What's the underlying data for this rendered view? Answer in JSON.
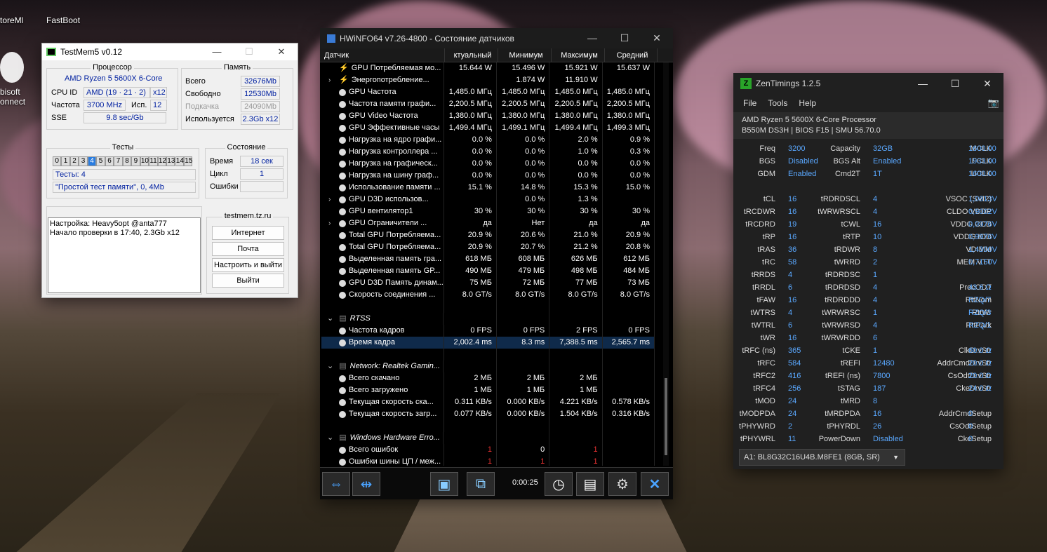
{
  "desktop": {
    "icons": [
      {
        "label": "toreMl"
      },
      {
        "label": "FastBoot"
      },
      {
        "label": "bisoft"
      },
      {
        "label": "onnect"
      }
    ]
  },
  "testmem": {
    "title": "TestMem5 v0.12",
    "cpu": {
      "group": "Процессор",
      "name": "AMD Ryzen 5 5600X 6-Core",
      "cpuid_label": "CPU ID",
      "cpuid": "AMD  (19 · 21 · 2)",
      "threads": "x12",
      "freq_label": "Частота",
      "freq": "3700 MHz",
      "use_label": "Исп.",
      "use": "12",
      "sse_label": "SSE",
      "sse": "9.8 sec/Gb"
    },
    "mem": {
      "group": "Память",
      "total_label": "Всего",
      "total": "32676Mb",
      "free_label": "Свободно",
      "free": "12530Mb",
      "swap_label": "Подкачка",
      "swap": "24090Mb",
      "used_label": "Используется",
      "used": "2.3Gb x12"
    },
    "tests": {
      "group": "Тесты",
      "cells": [
        "0",
        "1",
        "2",
        "3",
        "4",
        "5",
        "6",
        "7",
        "8",
        "9",
        "10",
        "11",
        "12",
        "13",
        "14",
        "15"
      ],
      "active": "4",
      "count": "Тесты: 4",
      "current": "\"Простой тест памяти\", 0, 4Mb"
    },
    "state": {
      "group": "Состояние",
      "time_label": "Время",
      "time": "18 сек",
      "cycle_label": "Цикл",
      "cycle": "1",
      "errors_label": "Ошибки",
      "errors": ""
    },
    "log": {
      "line1": "Настройка: Heavy5opt @anta777",
      "line2": "Начало проверки в 17:40, 2.3Gb x12"
    },
    "site": {
      "group": "testmem.tz.ru",
      "b1": "Интернет",
      "b2": "Почта",
      "b3": "Настроить и выйти",
      "b4": "Выйти"
    }
  },
  "hwinfo": {
    "title": "HWiNFO64 v7.26-4800 - Состояние датчиков",
    "headers": [
      "Датчик",
      "ктуальный",
      "Минимум",
      "Максимум",
      "Средний"
    ],
    "rows": [
      {
        "icon": "bolt",
        "name": "GPU Потребляемая мо...",
        "v": [
          "15.644 W",
          "15.496 W",
          "15.921 W",
          "15.637 W"
        ]
      },
      {
        "icon": "bolt",
        "chev": true,
        "name": "Энергопотребление...",
        "v": [
          "",
          "1.874 W",
          "11.910 W",
          ""
        ]
      },
      {
        "icon": "circle",
        "name": "GPU Частота",
        "v": [
          "1,485.0 МГц",
          "1,485.0 МГц",
          "1,485.0 МГц",
          "1,485.0 МГц"
        ]
      },
      {
        "icon": "circle",
        "name": "Частота памяти графи...",
        "v": [
          "2,200.5 МГц",
          "2,200.5 МГц",
          "2,200.5 МГц",
          "2,200.5 МГц"
        ]
      },
      {
        "icon": "circle",
        "name": "GPU Video Частота",
        "v": [
          "1,380.0 МГц",
          "1,380.0 МГц",
          "1,380.0 МГц",
          "1,380.0 МГц"
        ]
      },
      {
        "icon": "circle",
        "name": "GPU Эффективные часы",
        "v": [
          "1,499.4 МГц",
          "1,499.1 МГц",
          "1,499.4 МГц",
          "1,499.3 МГц"
        ]
      },
      {
        "icon": "circle",
        "name": "Нагрузка на ядро графи...",
        "v": [
          "0.0 %",
          "0.0 %",
          "2.0 %",
          "0.9 %"
        ]
      },
      {
        "icon": "circle",
        "name": "Нагрузка контроллера ...",
        "v": [
          "0.0 %",
          "0.0 %",
          "1.0 %",
          "0.3 %"
        ]
      },
      {
        "icon": "circle",
        "name": "Нагрузка на графическ...",
        "v": [
          "0.0 %",
          "0.0 %",
          "0.0 %",
          "0.0 %"
        ]
      },
      {
        "icon": "circle",
        "name": "Нагрузка на шину граф...",
        "v": [
          "0.0 %",
          "0.0 %",
          "0.0 %",
          "0.0 %"
        ]
      },
      {
        "icon": "circle",
        "name": "Использование памяти ...",
        "v": [
          "15.1 %",
          "14.8 %",
          "15.3 %",
          "15.0 %"
        ]
      },
      {
        "icon": "circle",
        "chev": true,
        "name": "GPU D3D использов...",
        "v": [
          "",
          "0.0 %",
          "1.3 %",
          ""
        ]
      },
      {
        "icon": "circle",
        "name": "GPU вентилятор1",
        "v": [
          "30 %",
          "30 %",
          "30 %",
          "30 %"
        ]
      },
      {
        "icon": "circle",
        "chev": true,
        "name": "GPU Ограничители ...",
        "v": [
          "да",
          "Нет",
          "да",
          "да"
        ]
      },
      {
        "icon": "circle",
        "name": "Total GPU Потребляема...",
        "v": [
          "20.9 %",
          "20.6 %",
          "21.0 %",
          "20.9 %"
        ]
      },
      {
        "icon": "circle",
        "name": "Total GPU Потребляема...",
        "v": [
          "20.9 %",
          "20.7 %",
          "21.2 %",
          "20.8 %"
        ]
      },
      {
        "icon": "circle",
        "name": "Выделенная память гра...",
        "v": [
          "618 МБ",
          "608 МБ",
          "626 МБ",
          "612 МБ"
        ]
      },
      {
        "icon": "circle",
        "name": "Выделенная память GP...",
        "v": [
          "490 МБ",
          "479 МБ",
          "498 МБ",
          "484 МБ"
        ]
      },
      {
        "icon": "circle",
        "name": "GPU D3D Память динам...",
        "v": [
          "75 МБ",
          "72 МБ",
          "77 МБ",
          "73 МБ"
        ]
      },
      {
        "icon": "circle",
        "name": "Скорость соединения ...",
        "v": [
          "8.0 GT/s",
          "8.0 GT/s",
          "8.0 GT/s",
          "8.0 GT/s"
        ]
      },
      {
        "blank": true
      },
      {
        "section": true,
        "name": "RTSS"
      },
      {
        "icon": "circle",
        "name": "Частота кадров",
        "v": [
          "0 FPS",
          "0 FPS",
          "2 FPS",
          "0 FPS"
        ]
      },
      {
        "icon": "circle",
        "name": "Время кадра",
        "sel": true,
        "v": [
          "2,002.4 ms",
          "8.3 ms",
          "7,388.5 ms",
          "2,565.7 ms"
        ]
      },
      {
        "blank": true
      },
      {
        "section": true,
        "name": "Network: Realtek Gamin..."
      },
      {
        "icon": "circle",
        "name": "Всего скачано",
        "v": [
          "2 МБ",
          "2 МБ",
          "2 МБ",
          ""
        ]
      },
      {
        "icon": "circle",
        "name": "Всего загружено",
        "v": [
          "1 МБ",
          "1 МБ",
          "1 МБ",
          ""
        ]
      },
      {
        "icon": "circle",
        "name": "Текущая скорость ска...",
        "v": [
          "0.311 KB/s",
          "0.000 KB/s",
          "4.221 KB/s",
          "0.578 KB/s"
        ]
      },
      {
        "icon": "circle",
        "name": "Текущая скорость загр...",
        "v": [
          "0.077 KB/s",
          "0.000 KB/s",
          "1.504 KB/s",
          "0.316 KB/s"
        ]
      },
      {
        "blank": true
      },
      {
        "section": true,
        "name": "Windows Hardware Erro..."
      },
      {
        "icon": "circle",
        "name": "Всего ошибок",
        "red": [
          true,
          false,
          true,
          false
        ],
        "v": [
          "1",
          "0",
          "1",
          ""
        ]
      },
      {
        "icon": "circle",
        "name": "Ошибки шины ЦП / меж...",
        "red": [
          true,
          true,
          true,
          false
        ],
        "v": [
          "1",
          "1",
          "1",
          ""
        ]
      }
    ],
    "timer": "0:00:25"
  },
  "zen": {
    "title": "ZenTimings 1.2.5",
    "menu": [
      "File",
      "Tools",
      "Help"
    ],
    "cpu": "AMD Ryzen 5 5600X 6-Core Processor",
    "board": "B550M DS3H | BIOS F15 | SMU 56.70.0",
    "rows": [
      [
        [
          "Freq",
          "3200"
        ],
        [
          "Capacity",
          "32GB"
        ],
        [
          "MCLK",
          "1600.00"
        ]
      ],
      [
        [
          "BGS",
          "Disabled"
        ],
        [
          "BGS Alt",
          "Enabled"
        ],
        [
          "FCLK",
          "1933.00"
        ]
      ],
      [
        [
          "GDM",
          "Enabled"
        ],
        [
          "Cmd2T",
          "1T"
        ],
        [
          "UCLK",
          "1600.00"
        ]
      ],
      null,
      [
        [
          "tCL",
          "16"
        ],
        [
          "tRDRDSCL",
          "4"
        ],
        [
          "VSOC (SVI2)",
          "1,0813V"
        ]
      ],
      [
        [
          "tRCDWR",
          "16"
        ],
        [
          "tWRWRSCL",
          "4"
        ],
        [
          "CLDO VDDP",
          "0,9002V"
        ]
      ],
      [
        [
          "tRCDRD",
          "19"
        ],
        [
          "tCWL",
          "16"
        ],
        [
          "VDDG CCD",
          "0,9976V"
        ]
      ],
      [
        [
          "tRP",
          "16"
        ],
        [
          "tRTP",
          "10"
        ],
        [
          "VDDG IOD",
          "0,9976V"
        ]
      ],
      [
        [
          "tRAS",
          "36"
        ],
        [
          "tRDWR",
          "8"
        ],
        [
          "VDIMM",
          "1,4300V"
        ]
      ],
      [
        [
          "tRC",
          "58"
        ],
        [
          "tWRRD",
          "2"
        ],
        [
          "MEM VTT",
          "0,7150V"
        ]
      ],
      [
        [
          "tRRDS",
          "4"
        ],
        [
          "tRDRDSC",
          "1"
        ],
        [
          "",
          ""
        ]
      ],
      [
        [
          "tRRDL",
          "6"
        ],
        [
          "tRDRDSD",
          "4"
        ],
        [
          "ProcODT",
          "43.6 Ω"
        ]
      ],
      [
        [
          "tFAW",
          "16"
        ],
        [
          "tRDRDDD",
          "4"
        ],
        [
          "RttNom",
          "RZQ/7"
        ]
      ],
      [
        [
          "tWTRS",
          "4"
        ],
        [
          "tWRWRSC",
          "1"
        ],
        [
          "RttWr",
          "RZQ/3"
        ]
      ],
      [
        [
          "tWTRL",
          "6"
        ],
        [
          "tWRWRSD",
          "4"
        ],
        [
          "RttPark",
          "RZQ/1"
        ]
      ],
      [
        [
          "tWR",
          "16"
        ],
        [
          "tWRWRDD",
          "6"
        ],
        [
          "",
          ""
        ]
      ],
      [
        [
          "tRFC (ns)",
          "365"
        ],
        [
          "tCKE",
          "1"
        ],
        [
          "ClkDrvStr",
          "60.0 Ω"
        ]
      ],
      [
        [
          "tRFC",
          "584"
        ],
        [
          "tREFI",
          "12480"
        ],
        [
          "AddrCmdDrvStr",
          "20.0 Ω"
        ]
      ],
      [
        [
          "tRFC2",
          "416"
        ],
        [
          "tREFI (ns)",
          "7800"
        ],
        [
          "CsOdtDrvStr",
          "20.0 Ω"
        ]
      ],
      [
        [
          "tRFC4",
          "256"
        ],
        [
          "tSTAG",
          "187"
        ],
        [
          "CkeDrvStr",
          "24.0 Ω"
        ]
      ],
      [
        [
          "tMOD",
          "24"
        ],
        [
          "tMRD",
          "8"
        ],
        [
          "",
          ""
        ]
      ],
      [
        [
          "tMODPDA",
          "24"
        ],
        [
          "tMRDPDA",
          "16"
        ],
        [
          "AddrCmdSetup",
          "0"
        ]
      ],
      [
        [
          "tPHYWRD",
          "2"
        ],
        [
          "tPHYRDL",
          "26"
        ],
        [
          "CsOdtSetup",
          "0"
        ]
      ],
      [
        [
          "tPHYWRL",
          "11"
        ],
        [
          "PowerDown",
          "Disabled"
        ],
        [
          "CkeSetup",
          "0"
        ]
      ]
    ],
    "module": "A1: BL8G32C16U4B.M8FE1 (8GB, SR)"
  }
}
